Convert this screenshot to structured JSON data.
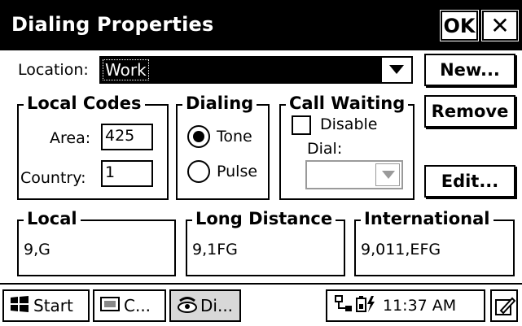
{
  "window": {
    "title": "Dialing Properties",
    "ok_label": "OK",
    "close_label": "✕"
  },
  "location": {
    "label": "Location:",
    "value": "Work"
  },
  "buttons": {
    "new": "New...",
    "remove": "Remove",
    "edit": "Edit..."
  },
  "local_codes": {
    "title": "Local Codes",
    "area_label": "Area:",
    "area_value": "425",
    "country_label": "Country:",
    "country_value": "1"
  },
  "dialing": {
    "title": "Dialing",
    "tone_label": "Tone",
    "pulse_label": "Pulse",
    "selected": "Tone"
  },
  "call_waiting": {
    "title": "Call Waiting",
    "disable_label": "Disable",
    "disable_checked": false,
    "dial_label": "Dial:",
    "dial_value": ""
  },
  "patterns": {
    "local": {
      "title": "Local",
      "value": "9,G"
    },
    "long_distance": {
      "title": "Long Distance",
      "value": "9,1FG"
    },
    "international": {
      "title": "International",
      "value": "9,011,EFG"
    }
  },
  "taskbar": {
    "start_label": "Start",
    "task1_label": "C...",
    "task2_label": "Di...",
    "time": "11:37 AM"
  }
}
